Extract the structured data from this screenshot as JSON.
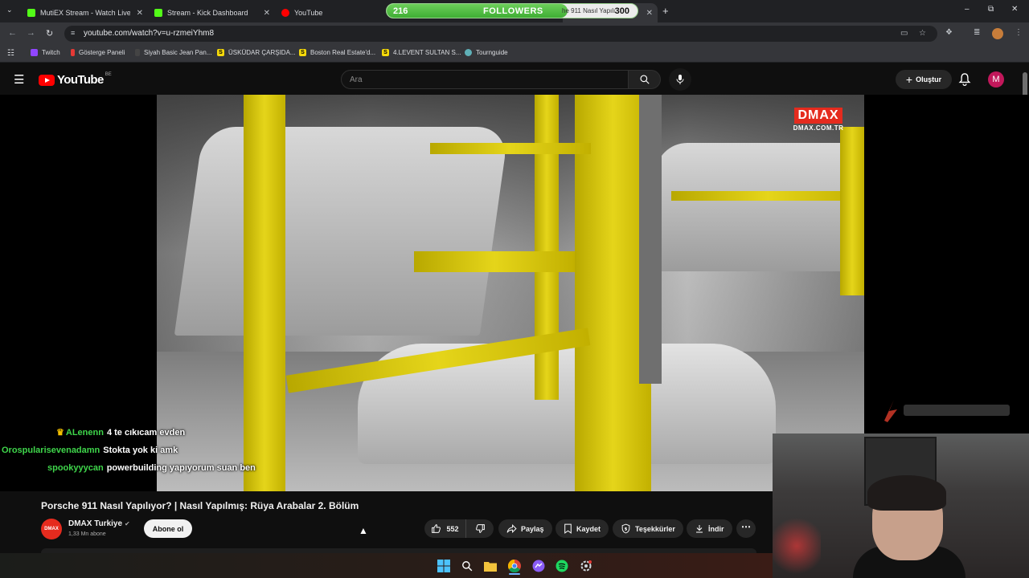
{
  "browser": {
    "tabs": [
      {
        "title": "MutiEX Stream - Watch Live on",
        "favicon_color": "#53fc18"
      },
      {
        "title": "Stream - Kick Dashboard",
        "favicon_color": "#53fc18"
      },
      {
        "title": "YouTube",
        "favicon_color": "#ff0000"
      }
    ],
    "active_tab_tail": "he 911 Nasıl Yapılı",
    "url": "youtube.com/watch?v=u-rzmeiYhm8",
    "bookmarks": [
      {
        "label": "Twitch",
        "icon_color": "#9146ff",
        "glyph": ""
      },
      {
        "label": "Gösterge Paneli",
        "icon_color": "#e53935",
        "glyph": ""
      },
      {
        "label": "Siyah Basic Jean Pan...",
        "icon_color": "#444444",
        "glyph": ""
      },
      {
        "label": "ÜSKÜDAR ÇARŞIDA...",
        "icon_color": "#f5d90a",
        "glyph": "S"
      },
      {
        "label": "Boston Real Estate'd...",
        "icon_color": "#f5d90a",
        "glyph": "S"
      },
      {
        "label": "4.LEVENT SULTAN S...",
        "icon_color": "#f5d90a",
        "glyph": "S"
      },
      {
        "label": "Tournguide",
        "icon_color": "#5fb0b7",
        "glyph": ""
      }
    ]
  },
  "followers_goal": {
    "current": "216",
    "label": "FOLLOWERS",
    "goal": "300",
    "progress": 0.72
  },
  "youtube": {
    "region": "BE",
    "logo_text": "YouTube",
    "search_placeholder": "Ara",
    "create_label": "Oluştur",
    "avatar_letter": "M"
  },
  "video": {
    "title": "Porsche 911 Nasıl Yapılıyor? | Nasıl Yapılmış: Rüya Arabalar 2. Bölüm",
    "dmax_logo": "DMAX",
    "dmax_url": "DMAX.COM.TR",
    "channel_name": "DMAX Turkiye",
    "channel_avatar_text": "DMAX",
    "subscribers": "1,33 Mn abone",
    "subscribe_label": "Abone ol",
    "likes": "552",
    "actions": {
      "share": "Paylaş",
      "save": "Kaydet",
      "thanks": "Teşekkürler",
      "download": "İndir"
    }
  },
  "chat": [
    {
      "user": "ALenenn",
      "message": "4 te cıkıcam evden",
      "badge": "crown"
    },
    {
      "user": "Orospularisevenadamn",
      "message": "Stokta yok ki amk",
      "badge": ""
    },
    {
      "user": "spookyyycan",
      "message": "powerbuilding yapıyorum suan ben",
      "badge": ""
    }
  ],
  "colors": {
    "accent_green": "#53fc18",
    "youtube_red": "#ff0000",
    "chat_user": "#3fd64b",
    "dmax_red": "#e52b1e"
  }
}
